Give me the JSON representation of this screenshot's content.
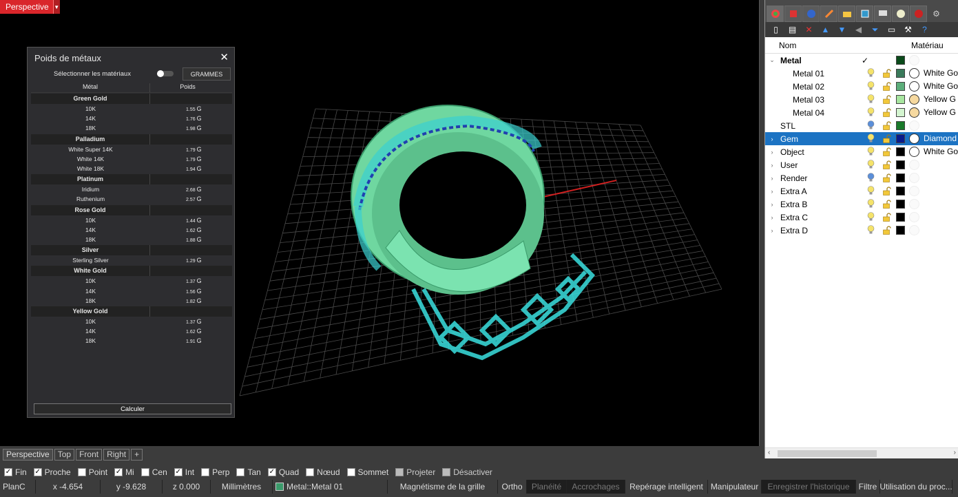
{
  "viewport": {
    "label": "Perspective",
    "menu_arrow": "▼"
  },
  "dialog": {
    "title": "Poids de métaux",
    "close": "✕",
    "select_label": "Sélectionner les matériaux",
    "units_button": "GRAMMES",
    "col_metal": "Métal",
    "col_weight": "Poids",
    "unit": "G",
    "groups": [
      {
        "name": "Green Gold",
        "rows": [
          {
            "name": "10K",
            "weight": "1.55"
          },
          {
            "name": "14K",
            "weight": "1.76"
          },
          {
            "name": "18K",
            "weight": "1.98"
          }
        ]
      },
      {
        "name": "Palladium",
        "rows": [
          {
            "name": "White Super 14K",
            "weight": "1.79"
          },
          {
            "name": "White 14K",
            "weight": "1.79"
          },
          {
            "name": "White 18K",
            "weight": "1.94"
          }
        ]
      },
      {
        "name": "Platinum",
        "rows": [
          {
            "name": "Iridium",
            "weight": "2.68"
          },
          {
            "name": "Ruthenium",
            "weight": "2.57"
          }
        ]
      },
      {
        "name": "Rose Gold",
        "rows": [
          {
            "name": "10K",
            "weight": "1.44"
          },
          {
            "name": "14K",
            "weight": "1.62"
          },
          {
            "name": "18K",
            "weight": "1.88"
          }
        ]
      },
      {
        "name": "Silver",
        "rows": [
          {
            "name": "Sterling Silver",
            "weight": "1.29"
          }
        ]
      },
      {
        "name": "White Gold",
        "rows": [
          {
            "name": "10K",
            "weight": "1.37"
          },
          {
            "name": "14K",
            "weight": "1.56"
          },
          {
            "name": "18K",
            "weight": "1.82"
          }
        ]
      },
      {
        "name": "Yellow Gold",
        "rows": [
          {
            "name": "10K",
            "weight": "1.37"
          },
          {
            "name": "14K",
            "weight": "1.62"
          },
          {
            "name": "18K",
            "weight": "1.91"
          }
        ]
      }
    ],
    "calc_button": "Calculer"
  },
  "panel": {
    "tab_icons": [
      "layers-icon",
      "materials-icon",
      "render-icon",
      "properties-icon",
      "display-icon",
      "named-views-icon",
      "help-icon",
      "gear-icon"
    ],
    "col_name": "Nom",
    "col_material": "Matériau",
    "current_mark": "✓",
    "layers": [
      {
        "name": "Metal",
        "expand": "⌄",
        "bold": true,
        "current": true,
        "color": "#0a4a1a",
        "bulb": "#f5e36a",
        "material": "",
        "mat_color": ""
      },
      {
        "name": "Metal 01",
        "expand": "",
        "indent": true,
        "color": "#3a7a5a",
        "bulb": "#f5e36a",
        "material": "White Go",
        "mat_color": "#ffffff"
      },
      {
        "name": "Metal 02",
        "expand": "",
        "indent": true,
        "color": "#5cae7a",
        "bulb": "#f5e36a",
        "material": "White Go",
        "mat_color": "#ffffff"
      },
      {
        "name": "Metal 03",
        "expand": "",
        "indent": true,
        "color": "#a8e6a0",
        "bulb": "#f5e36a",
        "material": "Yellow G",
        "mat_color": "#f6d9a0"
      },
      {
        "name": "Metal 04",
        "expand": "",
        "indent": true,
        "color": "#d4f5d0",
        "bulb": "#f5e36a",
        "material": "Yellow G",
        "mat_color": "#f6d9a0"
      },
      {
        "name": "STL",
        "expand": "",
        "color": "#1a7a2a",
        "bulb": "#5b8fd9",
        "material": "",
        "mat_color": ""
      },
      {
        "name": "Gem",
        "expand": "›",
        "selected": true,
        "color": "#0a1a8a",
        "bulb": "#f5e36a",
        "material": "Diamond",
        "mat_color": "#ffffff"
      },
      {
        "name": "Object",
        "expand": "›",
        "color": "#000000",
        "bulb": "#f5e36a",
        "material": "White Go",
        "mat_color": "#ffffff"
      },
      {
        "name": "User",
        "expand": "›",
        "color": "#000000",
        "bulb": "#f5e36a",
        "material": "",
        "mat_color": ""
      },
      {
        "name": "Render",
        "expand": "›",
        "color": "#000000",
        "bulb": "#5b8fd9",
        "material": "",
        "mat_color": ""
      },
      {
        "name": "Extra A",
        "expand": "›",
        "color": "#000000",
        "bulb": "#f5e36a",
        "material": "",
        "mat_color": ""
      },
      {
        "name": "Extra B",
        "expand": "›",
        "color": "#000000",
        "bulb": "#f5e36a",
        "material": "",
        "mat_color": ""
      },
      {
        "name": "Extra C",
        "expand": "›",
        "color": "#000000",
        "bulb": "#f5e36a",
        "material": "",
        "mat_color": ""
      },
      {
        "name": "Extra D",
        "expand": "›",
        "color": "#000000",
        "bulb": "#f5e36a",
        "material": "",
        "mat_color": ""
      }
    ]
  },
  "viewport_tabs": [
    "Perspective",
    "Top",
    "Front",
    "Right",
    "+"
  ],
  "osnaps": [
    {
      "label": "Fin",
      "checked": true
    },
    {
      "label": "Proche",
      "checked": true
    },
    {
      "label": "Point",
      "checked": false
    },
    {
      "label": "Mi",
      "checked": true
    },
    {
      "label": "Cen",
      "checked": false
    },
    {
      "label": "Int",
      "checked": true
    },
    {
      "label": "Perp",
      "checked": false
    },
    {
      "label": "Tan",
      "checked": false
    },
    {
      "label": "Quad",
      "checked": true
    },
    {
      "label": "Nœud",
      "checked": false
    },
    {
      "label": "Sommet",
      "checked": false
    },
    {
      "label": "Projeter",
      "checked": false,
      "disabled": true
    },
    {
      "label": "Désactiver",
      "checked": false,
      "disabled": true
    }
  ],
  "status": {
    "cplane": "PlanC",
    "x": "x -4.654",
    "y": "y -9.628",
    "z": "z 0.000",
    "units": "Millimètres",
    "layer": "Metal::Metal 01",
    "items": [
      {
        "label": "Magnétisme de la grille",
        "dark": false
      },
      {
        "label": "Ortho",
        "dark": false
      },
      {
        "label": "Planéité",
        "dark": true
      },
      {
        "label": "Accrochages",
        "dark": true
      },
      {
        "label": "Repérage intelligent",
        "dark": false
      },
      {
        "label": "Manipulateur",
        "dark": false
      },
      {
        "label": "Enregistrer l'historique",
        "dark": true
      },
      {
        "label": "Filtre",
        "dark": false
      },
      {
        "label": "Utilisation du proc...",
        "dark": false
      }
    ]
  }
}
